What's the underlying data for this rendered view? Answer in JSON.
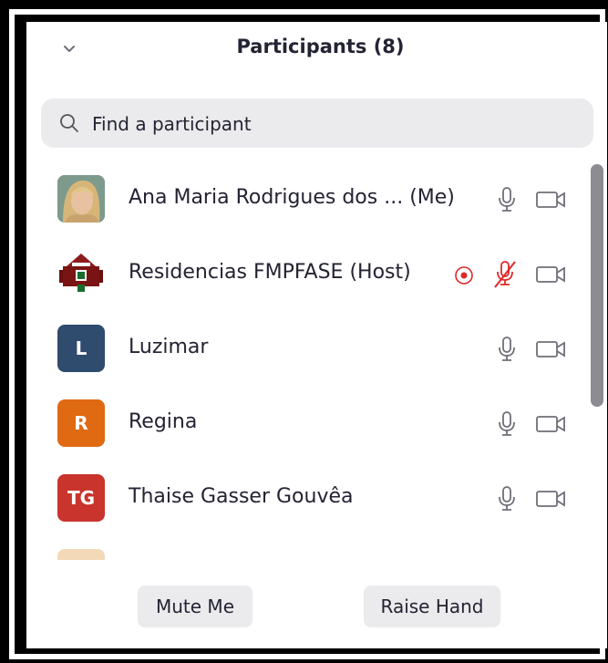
{
  "panel": {
    "title": "Participants (8)",
    "collapse_icon": "chevron-down-icon"
  },
  "search": {
    "placeholder": "Find a participant",
    "icon": "search-icon"
  },
  "participants": [
    {
      "name": "Ana Maria Rodrigues dos ... (Me)",
      "avatar": "photo",
      "mic": "on",
      "video": "off"
    },
    {
      "name": "Residencias FMPFASE (Host)",
      "avatar": "logo",
      "recording": true,
      "mic": "muted",
      "video": "off"
    },
    {
      "name": "Luzimar",
      "initials": "L",
      "avatar_color": "#2f4b6e",
      "mic": "on",
      "video": "off"
    },
    {
      "name": "Regina",
      "initials": "R",
      "avatar_color": "#e06a12",
      "mic": "on",
      "video": "off"
    },
    {
      "name": "Thaise Gasser Gouvêa",
      "initials": "TG",
      "avatar_color": "#c9342c",
      "mic": "on",
      "video": "off"
    }
  ],
  "footer": {
    "mute_label": "Mute Me",
    "raise_label": "Raise Hand"
  },
  "colors": {
    "muted_red": "#e02828",
    "icon_gray": "#6e6e78"
  }
}
